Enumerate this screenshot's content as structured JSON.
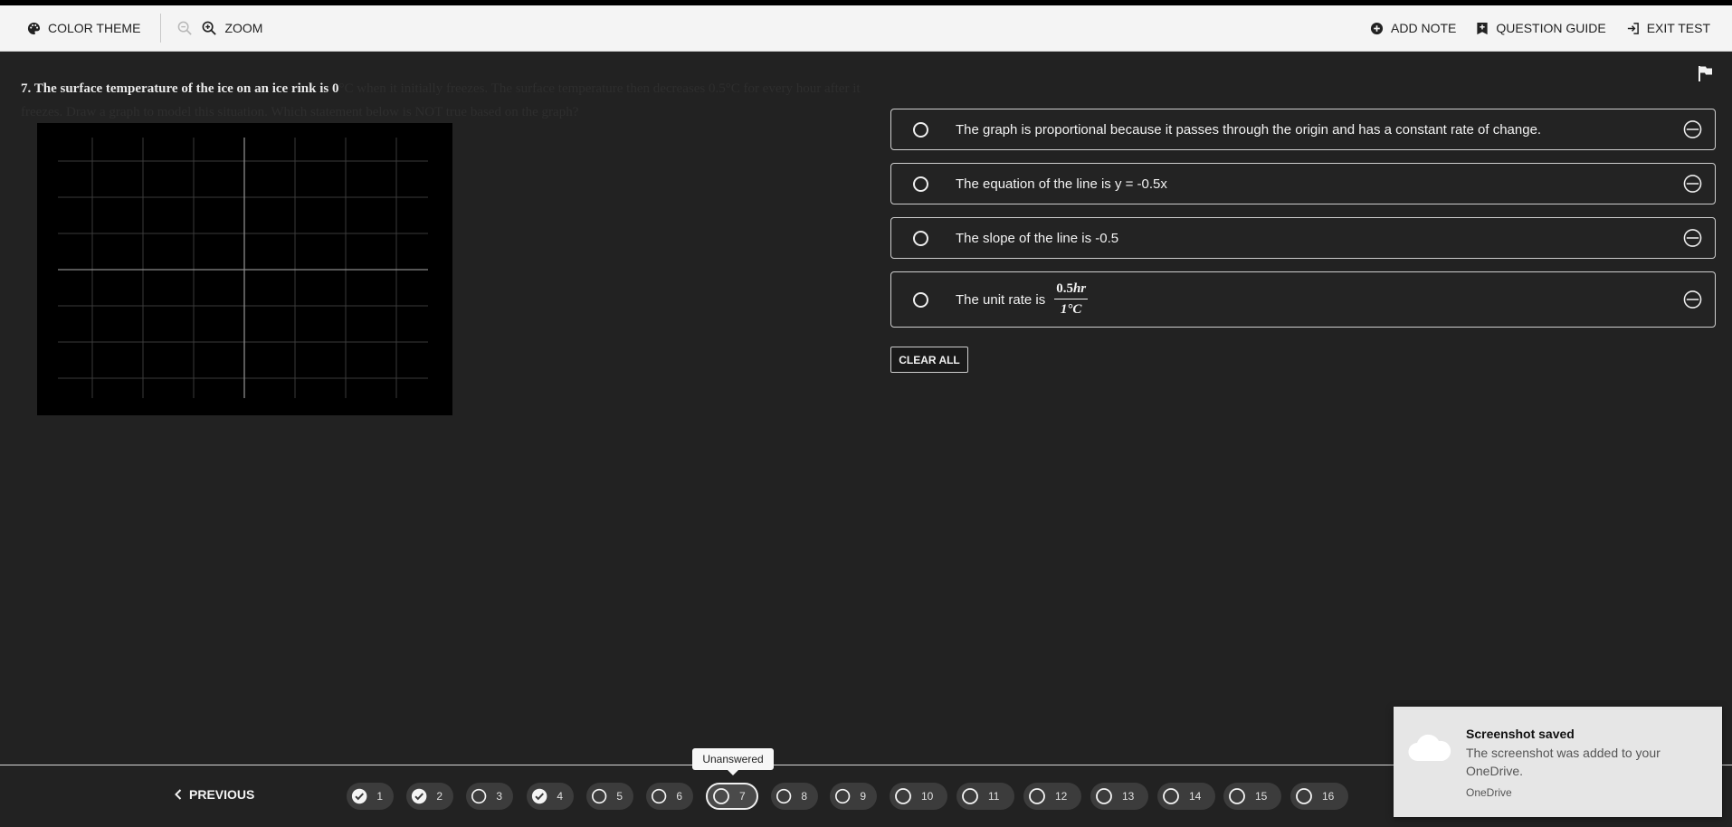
{
  "toolbar": {
    "color_theme": "COLOR THEME",
    "zoom": "ZOOM",
    "add_note": "ADD NOTE",
    "question_guide": "QUESTION GUIDE",
    "exit_test": "EXIT TEST"
  },
  "question": {
    "lead": "7. The surface temperature of the ice on an ice rink is 0",
    "rest": "°C when it initially freezes.  The surface temperature then decreases 0.5°C for every hour after it freezes.  Draw a graph to model this situation. Which statement below is NOT true based on the graph?"
  },
  "choices": [
    {
      "text": "The graph is proportional because it passes through the origin and has a constant rate of change."
    },
    {
      "text": "The equation of the line is y = -0.5x"
    },
    {
      "text": "The slope of the line is -0.5"
    },
    {
      "text": "The unit rate is",
      "fraction_num": "0.5",
      "fraction_num_unit": "hr",
      "fraction_den": "1°",
      "fraction_den_unit": "C"
    }
  ],
  "clear_all": "CLEAR ALL",
  "bottom": {
    "previous": "PREVIOUS",
    "tooltip": "Unanswered",
    "questions": [
      {
        "num": "1",
        "status": "answered"
      },
      {
        "num": "2",
        "status": "answered"
      },
      {
        "num": "3",
        "status": "unanswered"
      },
      {
        "num": "4",
        "status": "answered"
      },
      {
        "num": "5",
        "status": "unanswered"
      },
      {
        "num": "6",
        "status": "unanswered"
      },
      {
        "num": "7",
        "status": "current"
      },
      {
        "num": "8",
        "status": "unanswered"
      },
      {
        "num": "9",
        "status": "unanswered"
      },
      {
        "num": "10",
        "status": "unanswered"
      },
      {
        "num": "11",
        "status": "unanswered"
      },
      {
        "num": "12",
        "status": "unanswered"
      },
      {
        "num": "13",
        "status": "unanswered"
      },
      {
        "num": "14",
        "status": "unanswered"
      },
      {
        "num": "15",
        "status": "unanswered"
      },
      {
        "num": "16",
        "status": "unanswered"
      }
    ]
  },
  "toast": {
    "title": "Screenshot saved",
    "body": "The screenshot was added to your OneDrive.",
    "source": "OneDrive"
  },
  "colors": {
    "background": "#222222",
    "topbar": "#f4f4f4",
    "graph": "#000000"
  }
}
